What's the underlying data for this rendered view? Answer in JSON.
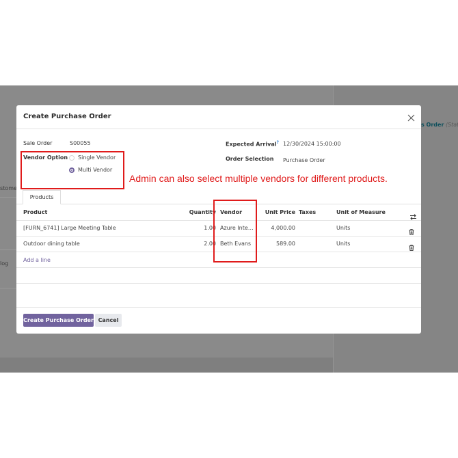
{
  "backdrop": {
    "left_labels": [
      "stome",
      "log"
    ],
    "order_text": "s Order",
    "status_text": "(Stat"
  },
  "modal": {
    "title": "Create Purchase Order",
    "fields": {
      "sale_order_label": "Sale Order",
      "sale_order_value": "S00055",
      "vendor_option_label": "Vendor Option",
      "single_vendor": "Single Vendor",
      "multi_vendor": "Multi Vendor",
      "expected_arrival_label": "Expected Arrival",
      "expected_arrival_help": "?",
      "expected_arrival_value": "12/30/2024 15:00:00",
      "order_selection_label": "Order Selection",
      "order_selection_value": "Purchase Order"
    },
    "tabs": [
      {
        "label": "Products"
      }
    ],
    "table": {
      "headers": [
        "Product",
        "Quantity",
        "Vendor",
        "Unit Price",
        "Taxes",
        "Unit of Measure"
      ],
      "rows": [
        {
          "product": "[FURN_6741] Large Meeting Table",
          "quantity": "1.00",
          "vendor": "Azure Inte…",
          "unit_price": "4,000.00",
          "taxes": "",
          "uom": "Units"
        },
        {
          "product": "Outdoor dining table",
          "quantity": "2.00",
          "vendor": "Beth Evans",
          "unit_price": "589.00",
          "taxes": "",
          "uom": "Units"
        }
      ],
      "add_line": "Add a line"
    },
    "buttons": {
      "create": "Create Purchase Order",
      "cancel": "Cancel"
    }
  },
  "annotation": {
    "text": "Admin can also select multiple vendors for different products.",
    "color": "#e01b1b"
  },
  "colors": {
    "primary": "#71639e",
    "backdrop": "#7f7f7f"
  }
}
